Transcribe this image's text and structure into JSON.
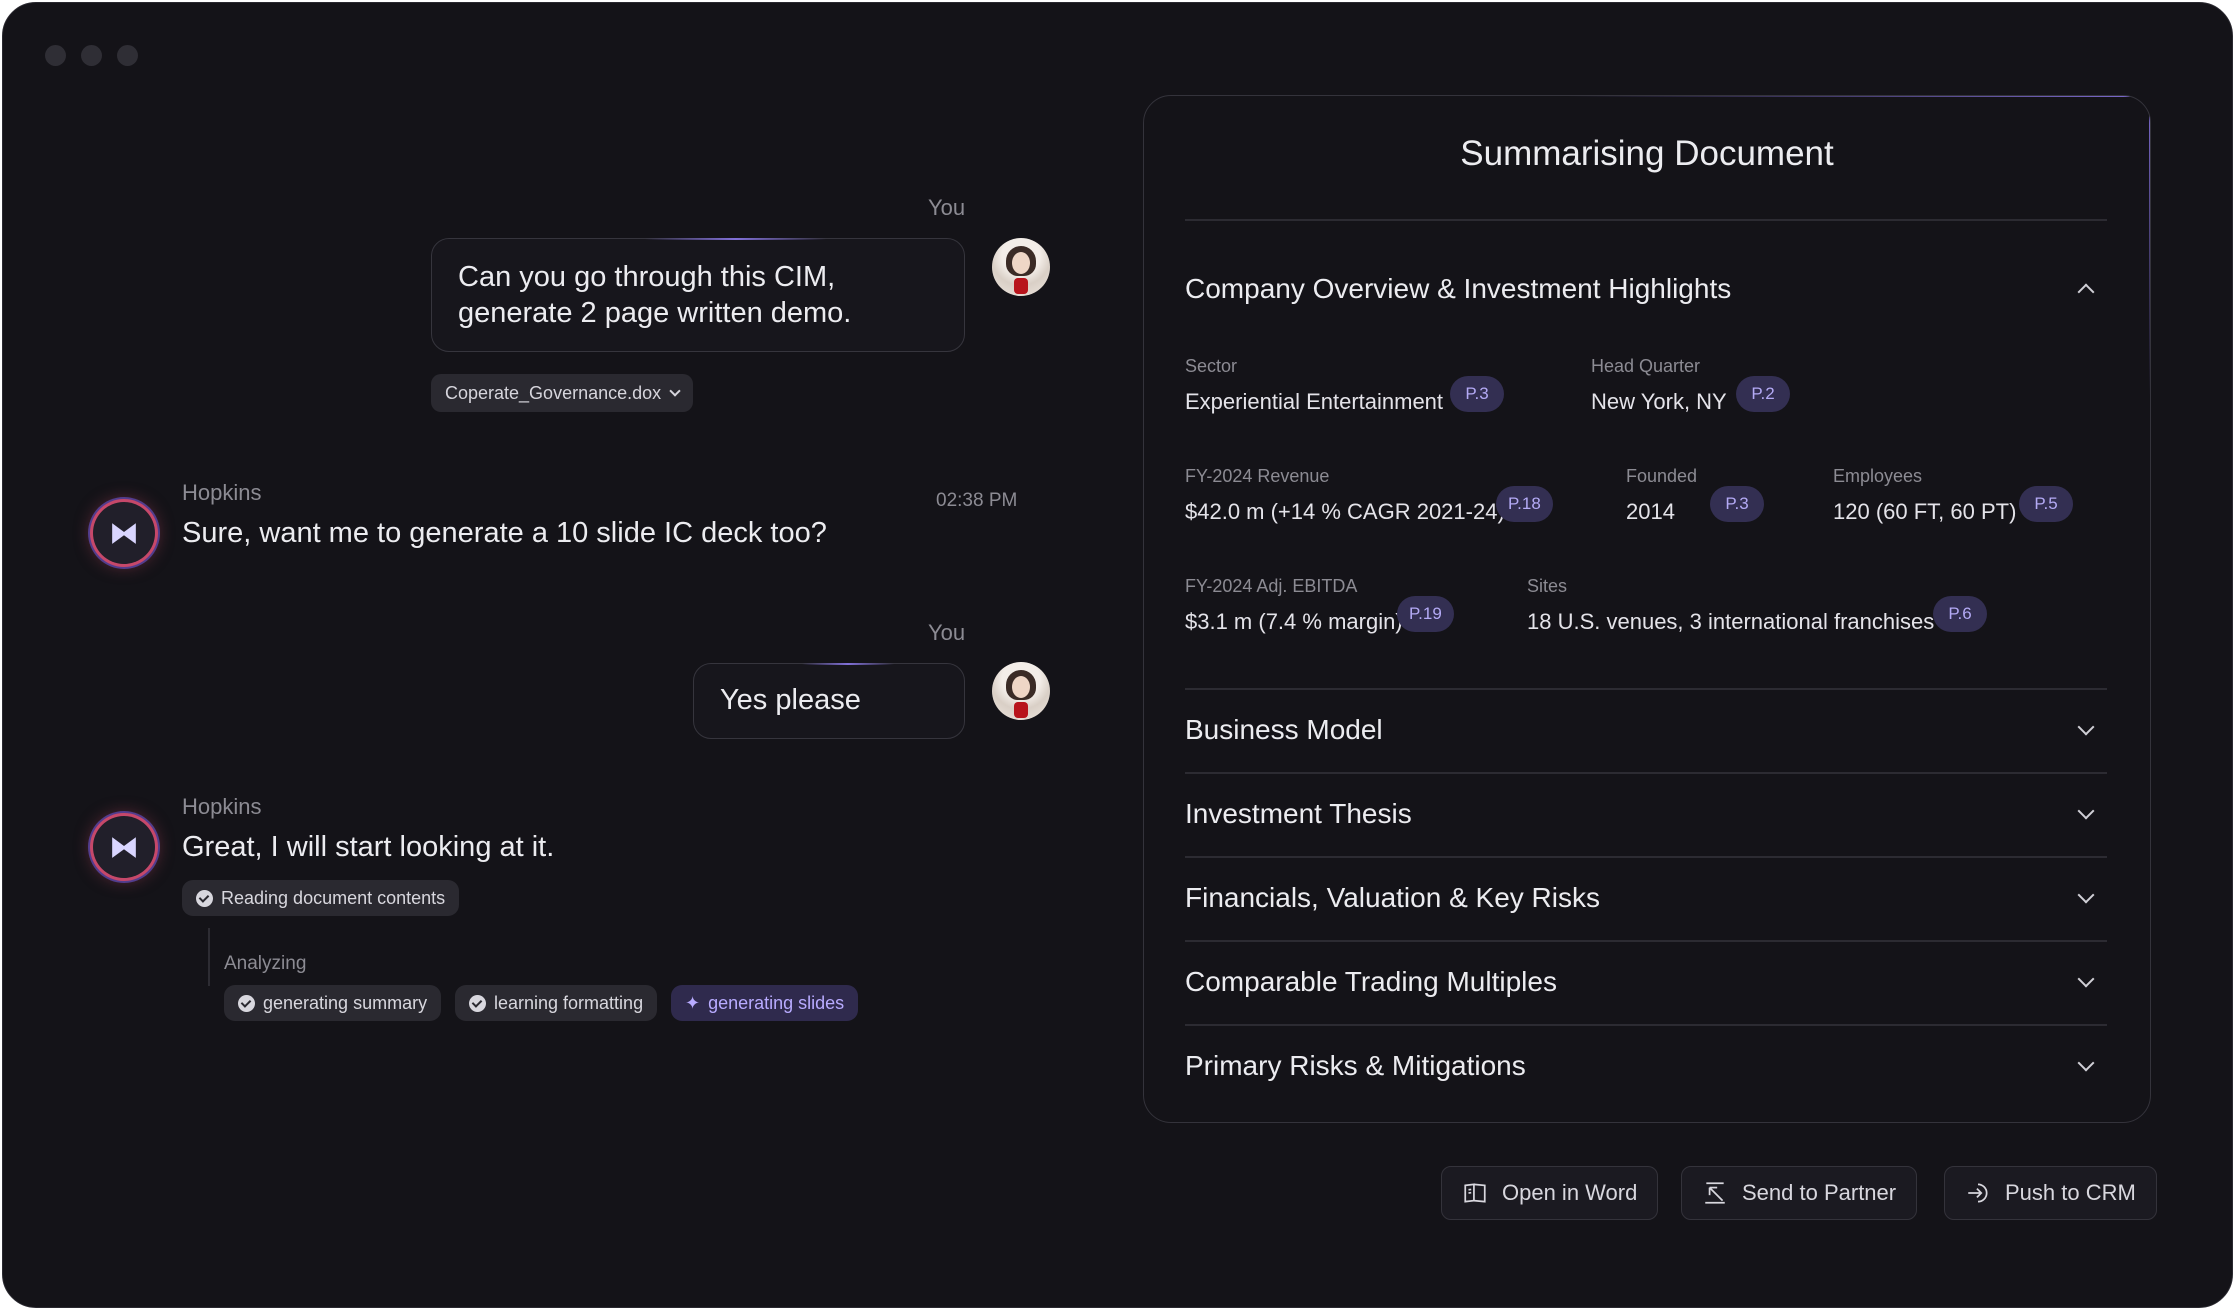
{
  "chat": {
    "messages": [
      {
        "sender": "You",
        "text_line1": "Can you go through this CIM,",
        "text_line2": "generate 2 page written demo.",
        "attachment": "Coperate_Governance.dox"
      },
      {
        "sender": "Hopkins",
        "text": "Sure, want me to generate a 10 slide IC deck too?",
        "time": "02:38 PM"
      },
      {
        "sender": "You",
        "text": "Yes please"
      },
      {
        "sender": "Hopkins",
        "text": "Great, I will start looking at it."
      }
    ],
    "progress": {
      "step": "Reading document contents",
      "analyzing_label": "Analyzing",
      "tasks": [
        {
          "label": "generating summary",
          "state": "done"
        },
        {
          "label": "learning formatting",
          "state": "done"
        },
        {
          "label": "generating slides",
          "state": "active"
        }
      ]
    }
  },
  "document": {
    "title": "Summarising Document",
    "sections": [
      {
        "title": "Company Overview & Investment Highlights",
        "expanded": true
      },
      {
        "title": "Business Model",
        "expanded": false
      },
      {
        "title": "Investment Thesis",
        "expanded": false
      },
      {
        "title": "Financials, Valuation & Key Risks",
        "expanded": false
      },
      {
        "title": "Comparable Trading Multiples",
        "expanded": false
      },
      {
        "title": "Primary Risks & Mitigations",
        "expanded": false
      }
    ],
    "fields": {
      "sector": {
        "label": "Sector",
        "value": "Experiential Entertainment",
        "page": "P.3"
      },
      "hq": {
        "label": "Head Quarter",
        "value": "New York, NY",
        "page": "P.2"
      },
      "revenue": {
        "label": "FY-2024 Revenue",
        "value": "$42.0 m (+14 % CAGR 2021-24)",
        "page": "P.18"
      },
      "founded": {
        "label": "Founded",
        "value": "2014",
        "page": "P.3"
      },
      "employees": {
        "label": "Employees",
        "value": "120 (60 FT, 60 PT)",
        "page": "P.5"
      },
      "ebitda": {
        "label": "FY-2024 Adj. EBITDA",
        "value": "$3.1 m (7.4 % margin)",
        "page": "P.19"
      },
      "sites": {
        "label": "Sites",
        "value": "18 U.S. venues, 3 international franchises",
        "page": "P.6"
      }
    }
  },
  "actions": {
    "open_word": "Open in Word",
    "send_partner": "Send to Partner",
    "push_crm": "Push to CRM"
  },
  "colors": {
    "background": "#141318",
    "accent": "#7c6ad0",
    "badge": "#332f52"
  }
}
